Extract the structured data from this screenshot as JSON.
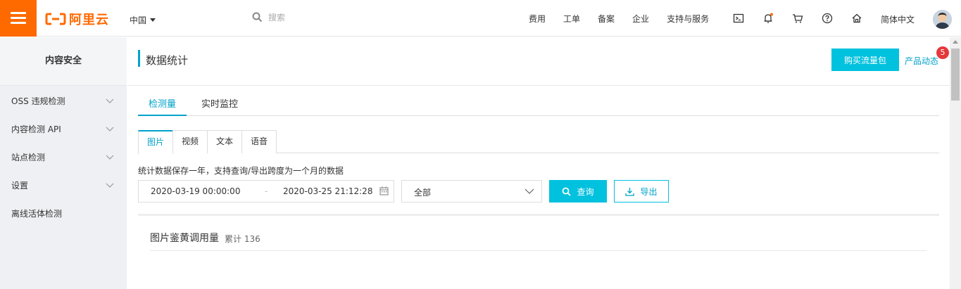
{
  "header": {
    "brand": "阿里云",
    "region": "中国",
    "search_placeholder": "搜索",
    "nav": [
      "费用",
      "工单",
      "备案",
      "企业",
      "支持与服务"
    ],
    "language": "简体中文",
    "icons": [
      "terminal-icon",
      "bell-icon",
      "cart-icon",
      "help-icon",
      "home-icon"
    ],
    "accent": "#ff6a00"
  },
  "sidebar": {
    "title": "内容安全",
    "items": [
      {
        "label": "OSS 违规检测",
        "expandable": true
      },
      {
        "label": "内容检测 API",
        "expandable": true
      },
      {
        "label": "站点检测",
        "expandable": true
      },
      {
        "label": "设置",
        "expandable": true
      },
      {
        "label": "离线活体检测",
        "expandable": false
      }
    ]
  },
  "main": {
    "title": "数据统计",
    "buy_button": "购买流量包",
    "product_news": "产品动态",
    "news_badge": "5",
    "tabs": [
      "检测量",
      "实时监控"
    ],
    "active_tab": "检测量",
    "subtabs": [
      "图片",
      "视频",
      "文本",
      "语音"
    ],
    "active_subtab": "图片",
    "note": "统计数据保存一年，支持查询/导出跨度为一个月的数据",
    "date_start": "2020-03-19 00:00:00",
    "date_sep": "-",
    "date_end": "2020-03-25 21:12:28",
    "scope_select": "全部",
    "query_button": "查询",
    "export_button": "导出",
    "panel_title": "图片鉴黄调用量",
    "panel_total_label": "累计 136"
  }
}
